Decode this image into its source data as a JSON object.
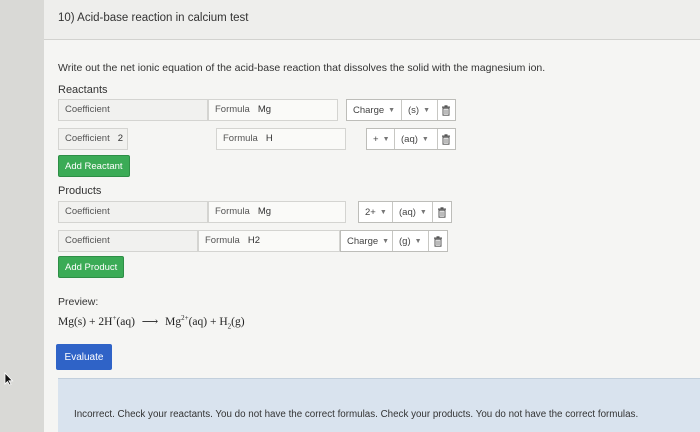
{
  "question": {
    "title": "10) Acid-base reaction in calcium test",
    "instruction": "Write out the net ionic equation of the acid-base reaction that dissolves the solid with the magnesium ion."
  },
  "reactants": {
    "label": "Reactants",
    "rows": [
      {
        "coefficient_label": "Coefficient",
        "coefficient": "",
        "formula_label": "Formula",
        "formula": "Mg",
        "charge": "Charge",
        "state": "(s)"
      },
      {
        "coefficient_label": "Coefficient",
        "coefficient": "2",
        "formula_label": "Formula",
        "formula": "H",
        "charge": "+",
        "state": "(aq)"
      }
    ],
    "add_button": "Add Reactant"
  },
  "products": {
    "label": "Products",
    "rows": [
      {
        "coefficient_label": "Coefficient",
        "coefficient": "",
        "formula_label": "Formula",
        "formula": "Mg",
        "charge": "2+",
        "state": "(aq)"
      },
      {
        "coefficient_label": "Coefficient",
        "coefficient": "",
        "formula_label": "Formula",
        "formula": "H2",
        "charge": "Charge",
        "state": "(g)"
      }
    ],
    "add_button": "Add Product"
  },
  "preview": {
    "label": "Preview:",
    "r1": "Mg(s)",
    "plus1": "+",
    "r2_coef": "2",
    "r2_formula": "H",
    "r2_charge": "+",
    "r2_state": "(aq)",
    "arrow": "⟶",
    "p1_formula": "Mg",
    "p1_charge": "2+",
    "p1_state": "(aq)",
    "plus2": "+",
    "p2_formula": "H",
    "p2_sub": "2",
    "p2_state": "(g)"
  },
  "evaluate_button": "Evaluate",
  "feedback": "Incorrect. Check your reactants. You do not have the correct formulas. Check your products. You do not have the correct formulas.",
  "icons": {
    "trash": "trash-icon",
    "caret": "caret-down-icon",
    "cursor": "mouse-cursor-icon"
  },
  "colors": {
    "add_button": "#3bab56",
    "evaluate_button": "#2f63c7",
    "feedback_bg": "#d9e3ee"
  }
}
